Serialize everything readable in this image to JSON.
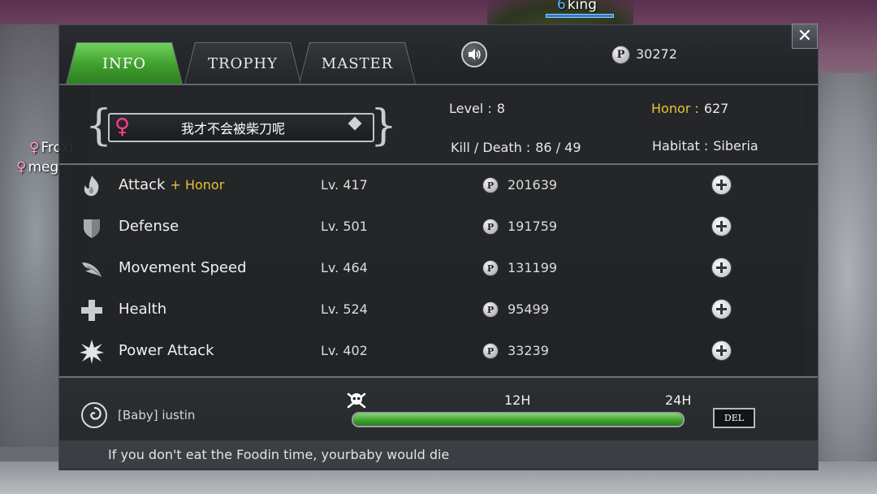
{
  "world": {
    "players": [
      {
        "symbol": "6",
        "name": "king"
      },
      {
        "symbol": "♀",
        "name": "Froxi"
      },
      {
        "symbol": "♀",
        "name": "meg"
      }
    ]
  },
  "tabs": [
    {
      "label": "INFO",
      "active": true
    },
    {
      "label": "TROPHY",
      "active": false
    },
    {
      "label": "MASTER",
      "active": false
    }
  ],
  "header": {
    "points": "30272",
    "coin_symbol": "P",
    "close_symbol": "✕"
  },
  "profile": {
    "gender_icon": "♀",
    "name": "我才不会被柴刀呢",
    "level_label": "Level :",
    "level_value": "8",
    "kd_label": "Kill / Death :",
    "kd_value": "86  /  49",
    "honor_label": "Honor :",
    "honor_value": "627",
    "habitat_label": "Habitat :",
    "habitat_value": "Siberia"
  },
  "upgrades": [
    {
      "name": "Attack",
      "bonus": "+ Honor",
      "level": "Lv. 417",
      "cost": "201639",
      "icon": "flame-icon"
    },
    {
      "name": "Defense",
      "bonus": "",
      "level": "Lv. 501",
      "cost": "191759",
      "icon": "shield-icon"
    },
    {
      "name": "Movement Speed",
      "bonus": "",
      "level": "Lv. 464",
      "cost": "131199",
      "icon": "wing-icon"
    },
    {
      "name": "Health",
      "bonus": "",
      "level": "Lv. 524",
      "cost": "95499",
      "icon": "cross-icon"
    },
    {
      "name": "Power Attack",
      "bonus": "",
      "level": "Lv. 402",
      "cost": "33239",
      "icon": "burst-icon"
    }
  ],
  "baby": {
    "name": "[Baby]  iustin",
    "mark_12": "12H",
    "mark_24": "24H",
    "food_fraction": 1.0,
    "del_label": "DEL",
    "warning": "If you don't eat the Foodin time, yourbaby would die"
  },
  "colors": {
    "accent_green": "#3f9e2e",
    "honor_gold": "#e8c23a",
    "female_pink": "#ff3d8a"
  }
}
